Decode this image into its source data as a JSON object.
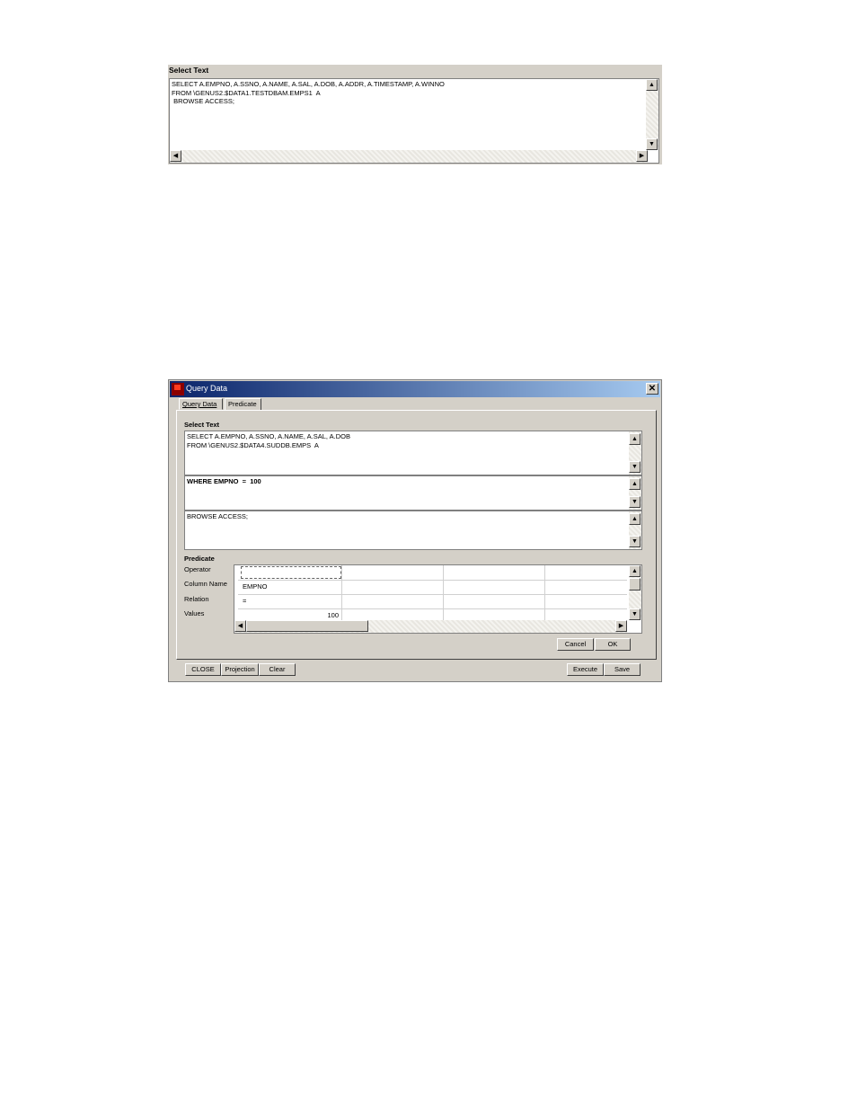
{
  "top_panel": {
    "title": "Select Text",
    "text": "SELECT A.EMPNO, A.SSNO, A.NAME, A.SAL, A.DOB, A.ADDR, A.TIMESTAMP, A.WINNO\nFROM \\GENUS2.$DATA1.TESTDBAM.EMPS1  A\n BROWSE ACCESS;"
  },
  "dialog": {
    "title": "Query Data",
    "tabs": [
      "Query Data",
      "Predicate"
    ],
    "select_text_label": "Select Text",
    "select_text": "SELECT A.EMPNO, A.SSNO, A.NAME, A.SAL, A.DOB\nFROM \\GENUS2.$DATA4.SUDDB.EMPS  A",
    "where_text": "WHERE EMPNO  =  100",
    "access_text": "BROWSE ACCESS;",
    "predicate_label": "Predicate",
    "predicate_rows": [
      {
        "label": "Operator",
        "value": ""
      },
      {
        "label": "Column Name",
        "value": "EMPNO"
      },
      {
        "label": "Relation",
        "value": "="
      },
      {
        "label": "Values",
        "value": "100"
      }
    ],
    "inner_buttons": {
      "cancel": "Cancel",
      "ok": "OK"
    },
    "bottom_buttons": {
      "close": "CLOSE",
      "projection": "Projection",
      "clear": "Clear",
      "execute": "Execute",
      "save": "Save"
    }
  }
}
